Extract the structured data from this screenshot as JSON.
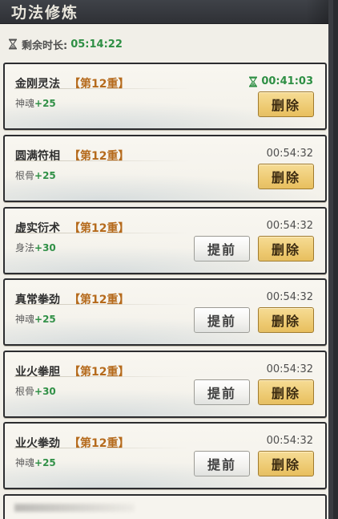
{
  "header": {
    "title": "功法修炼"
  },
  "timer": {
    "label": "剩余时长:",
    "value": "05:14:22"
  },
  "buttons": {
    "delete_label": "删除",
    "advance_label": "提前"
  },
  "cards": [
    {
      "name": "金刚灵法",
      "level": "【第12重】",
      "stat_label": "神魂",
      "stat_value": "+25",
      "time": "00:41:03",
      "active": true,
      "has_advance": false
    },
    {
      "name": "圆满符相",
      "level": "【第12重】",
      "stat_label": "根骨",
      "stat_value": "+25",
      "time": "00:54:32",
      "active": false,
      "has_advance": false
    },
    {
      "name": "虚实衍术",
      "level": "【第12重】",
      "stat_label": "身法",
      "stat_value": "+30",
      "time": "00:54:32",
      "active": false,
      "has_advance": true
    },
    {
      "name": "真常拳劲",
      "level": "【第12重】",
      "stat_label": "神魂",
      "stat_value": "+25",
      "time": "00:54:32",
      "active": false,
      "has_advance": true
    },
    {
      "name": "业火拳胆",
      "level": "【第12重】",
      "stat_label": "根骨",
      "stat_value": "+30",
      "time": "00:54:32",
      "active": false,
      "has_advance": true
    },
    {
      "name": "业火拳劲",
      "level": "【第12重】",
      "stat_label": "神魂",
      "stat_value": "+25",
      "time": "00:54:32",
      "active": false,
      "has_advance": true
    }
  ],
  "colors": {
    "accent_green": "#2e8f44",
    "level_orange": "#b56a1c",
    "delete_gold": "#e8bf5d"
  },
  "icons": {
    "timer": "hourglass-icon"
  }
}
